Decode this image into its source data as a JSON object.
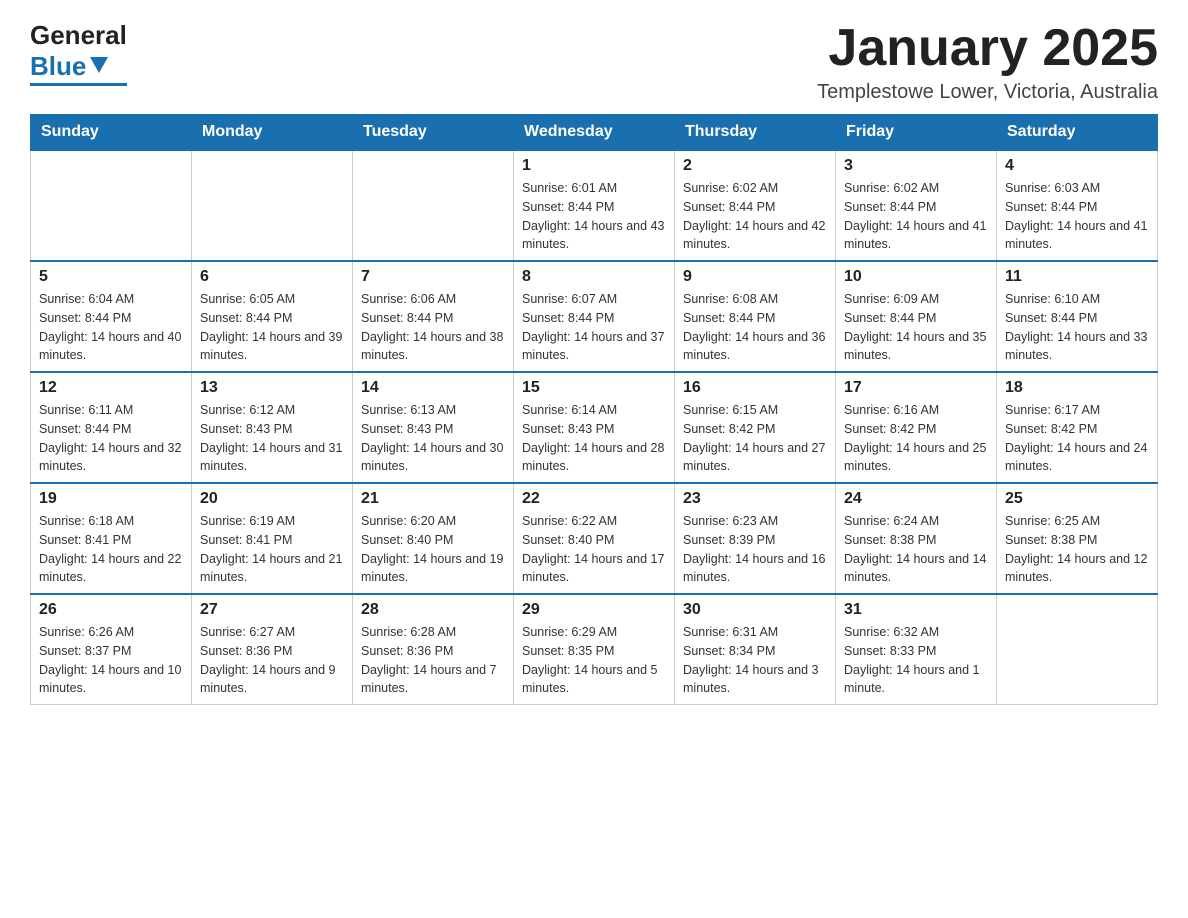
{
  "header": {
    "logo": {
      "general": "General",
      "blue": "Blue",
      "triangle": "▶"
    },
    "title": "January 2025",
    "location": "Templestowe Lower, Victoria, Australia"
  },
  "calendar": {
    "days_of_week": [
      "Sunday",
      "Monday",
      "Tuesday",
      "Wednesday",
      "Thursday",
      "Friday",
      "Saturday"
    ],
    "weeks": [
      [
        {
          "day": "",
          "sunrise": "",
          "sunset": "",
          "daylight": ""
        },
        {
          "day": "",
          "sunrise": "",
          "sunset": "",
          "daylight": ""
        },
        {
          "day": "",
          "sunrise": "",
          "sunset": "",
          "daylight": ""
        },
        {
          "day": "1",
          "sunrise": "Sunrise: 6:01 AM",
          "sunset": "Sunset: 8:44 PM",
          "daylight": "Daylight: 14 hours and 43 minutes."
        },
        {
          "day": "2",
          "sunrise": "Sunrise: 6:02 AM",
          "sunset": "Sunset: 8:44 PM",
          "daylight": "Daylight: 14 hours and 42 minutes."
        },
        {
          "day": "3",
          "sunrise": "Sunrise: 6:02 AM",
          "sunset": "Sunset: 8:44 PM",
          "daylight": "Daylight: 14 hours and 41 minutes."
        },
        {
          "day": "4",
          "sunrise": "Sunrise: 6:03 AM",
          "sunset": "Sunset: 8:44 PM",
          "daylight": "Daylight: 14 hours and 41 minutes."
        }
      ],
      [
        {
          "day": "5",
          "sunrise": "Sunrise: 6:04 AM",
          "sunset": "Sunset: 8:44 PM",
          "daylight": "Daylight: 14 hours and 40 minutes."
        },
        {
          "day": "6",
          "sunrise": "Sunrise: 6:05 AM",
          "sunset": "Sunset: 8:44 PM",
          "daylight": "Daylight: 14 hours and 39 minutes."
        },
        {
          "day": "7",
          "sunrise": "Sunrise: 6:06 AM",
          "sunset": "Sunset: 8:44 PM",
          "daylight": "Daylight: 14 hours and 38 minutes."
        },
        {
          "day": "8",
          "sunrise": "Sunrise: 6:07 AM",
          "sunset": "Sunset: 8:44 PM",
          "daylight": "Daylight: 14 hours and 37 minutes."
        },
        {
          "day": "9",
          "sunrise": "Sunrise: 6:08 AM",
          "sunset": "Sunset: 8:44 PM",
          "daylight": "Daylight: 14 hours and 36 minutes."
        },
        {
          "day": "10",
          "sunrise": "Sunrise: 6:09 AM",
          "sunset": "Sunset: 8:44 PM",
          "daylight": "Daylight: 14 hours and 35 minutes."
        },
        {
          "day": "11",
          "sunrise": "Sunrise: 6:10 AM",
          "sunset": "Sunset: 8:44 PM",
          "daylight": "Daylight: 14 hours and 33 minutes."
        }
      ],
      [
        {
          "day": "12",
          "sunrise": "Sunrise: 6:11 AM",
          "sunset": "Sunset: 8:44 PM",
          "daylight": "Daylight: 14 hours and 32 minutes."
        },
        {
          "day": "13",
          "sunrise": "Sunrise: 6:12 AM",
          "sunset": "Sunset: 8:43 PM",
          "daylight": "Daylight: 14 hours and 31 minutes."
        },
        {
          "day": "14",
          "sunrise": "Sunrise: 6:13 AM",
          "sunset": "Sunset: 8:43 PM",
          "daylight": "Daylight: 14 hours and 30 minutes."
        },
        {
          "day": "15",
          "sunrise": "Sunrise: 6:14 AM",
          "sunset": "Sunset: 8:43 PM",
          "daylight": "Daylight: 14 hours and 28 minutes."
        },
        {
          "day": "16",
          "sunrise": "Sunrise: 6:15 AM",
          "sunset": "Sunset: 8:42 PM",
          "daylight": "Daylight: 14 hours and 27 minutes."
        },
        {
          "day": "17",
          "sunrise": "Sunrise: 6:16 AM",
          "sunset": "Sunset: 8:42 PM",
          "daylight": "Daylight: 14 hours and 25 minutes."
        },
        {
          "day": "18",
          "sunrise": "Sunrise: 6:17 AM",
          "sunset": "Sunset: 8:42 PM",
          "daylight": "Daylight: 14 hours and 24 minutes."
        }
      ],
      [
        {
          "day": "19",
          "sunrise": "Sunrise: 6:18 AM",
          "sunset": "Sunset: 8:41 PM",
          "daylight": "Daylight: 14 hours and 22 minutes."
        },
        {
          "day": "20",
          "sunrise": "Sunrise: 6:19 AM",
          "sunset": "Sunset: 8:41 PM",
          "daylight": "Daylight: 14 hours and 21 minutes."
        },
        {
          "day": "21",
          "sunrise": "Sunrise: 6:20 AM",
          "sunset": "Sunset: 8:40 PM",
          "daylight": "Daylight: 14 hours and 19 minutes."
        },
        {
          "day": "22",
          "sunrise": "Sunrise: 6:22 AM",
          "sunset": "Sunset: 8:40 PM",
          "daylight": "Daylight: 14 hours and 17 minutes."
        },
        {
          "day": "23",
          "sunrise": "Sunrise: 6:23 AM",
          "sunset": "Sunset: 8:39 PM",
          "daylight": "Daylight: 14 hours and 16 minutes."
        },
        {
          "day": "24",
          "sunrise": "Sunrise: 6:24 AM",
          "sunset": "Sunset: 8:38 PM",
          "daylight": "Daylight: 14 hours and 14 minutes."
        },
        {
          "day": "25",
          "sunrise": "Sunrise: 6:25 AM",
          "sunset": "Sunset: 8:38 PM",
          "daylight": "Daylight: 14 hours and 12 minutes."
        }
      ],
      [
        {
          "day": "26",
          "sunrise": "Sunrise: 6:26 AM",
          "sunset": "Sunset: 8:37 PM",
          "daylight": "Daylight: 14 hours and 10 minutes."
        },
        {
          "day": "27",
          "sunrise": "Sunrise: 6:27 AM",
          "sunset": "Sunset: 8:36 PM",
          "daylight": "Daylight: 14 hours and 9 minutes."
        },
        {
          "day": "28",
          "sunrise": "Sunrise: 6:28 AM",
          "sunset": "Sunset: 8:36 PM",
          "daylight": "Daylight: 14 hours and 7 minutes."
        },
        {
          "day": "29",
          "sunrise": "Sunrise: 6:29 AM",
          "sunset": "Sunset: 8:35 PM",
          "daylight": "Daylight: 14 hours and 5 minutes."
        },
        {
          "day": "30",
          "sunrise": "Sunrise: 6:31 AM",
          "sunset": "Sunset: 8:34 PM",
          "daylight": "Daylight: 14 hours and 3 minutes."
        },
        {
          "day": "31",
          "sunrise": "Sunrise: 6:32 AM",
          "sunset": "Sunset: 8:33 PM",
          "daylight": "Daylight: 14 hours and 1 minute."
        },
        {
          "day": "",
          "sunrise": "",
          "sunset": "",
          "daylight": ""
        }
      ]
    ]
  }
}
